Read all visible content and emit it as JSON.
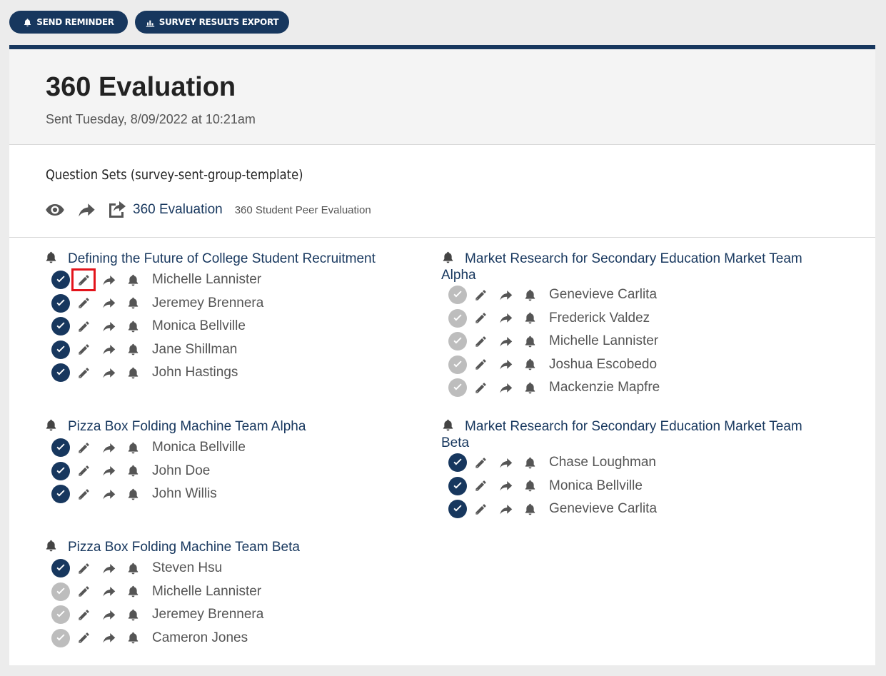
{
  "toolbar": {
    "send_reminder": "SEND REMINDER",
    "survey_results_export": "SURVEY RESULTS EXPORT"
  },
  "header": {
    "title": "360 Evaluation",
    "sent": "Sent Tuesday, 8/09/2022 at 10:21am"
  },
  "question_sets": {
    "title": "Question Sets (survey-sent-group-template)",
    "link": "360 Evaluation",
    "description": "360 Student Peer Evaluation"
  },
  "groups": [
    {
      "name": "Defining the Future of College Student Recruitment",
      "members": [
        {
          "name": "Michelle Lannister",
          "status": "completed"
        },
        {
          "name": "Jeremey Brennera",
          "status": "completed"
        },
        {
          "name": "Monica Bellville",
          "status": "completed"
        },
        {
          "name": "Jane Shillman",
          "status": "completed"
        },
        {
          "name": "John Hastings",
          "status": "completed"
        }
      ]
    },
    {
      "name": "Pizza Box Folding Machine Team Alpha",
      "members": [
        {
          "name": "Monica Bellville",
          "status": "completed"
        },
        {
          "name": "John Doe",
          "status": "completed"
        },
        {
          "name": "John Willis",
          "status": "completed"
        }
      ]
    },
    {
      "name": "Pizza Box Folding Machine Team Beta",
      "members": [
        {
          "name": "Steven Hsu",
          "status": "completed"
        },
        {
          "name": "Michelle Lannister",
          "status": "pending"
        },
        {
          "name": "Jeremey Brennera",
          "status": "pending"
        },
        {
          "name": "Cameron Jones",
          "status": "pending"
        }
      ]
    },
    {
      "name": "Market Research for Secondary Education Market Team Alpha",
      "members": [
        {
          "name": "Genevieve Carlita",
          "status": "pending"
        },
        {
          "name": "Frederick Valdez",
          "status": "pending"
        },
        {
          "name": "Michelle Lannister",
          "status": "pending"
        },
        {
          "name": "Joshua Escobedo",
          "status": "pending"
        },
        {
          "name": "Mackenzie Mapfre",
          "status": "pending"
        }
      ]
    },
    {
      "name": "Market Research for Secondary Education Market Team Beta",
      "members": [
        {
          "name": "Chase Loughman",
          "status": "completed"
        },
        {
          "name": "Monica Bellville",
          "status": "completed"
        },
        {
          "name": "Genevieve Carlita",
          "status": "completed"
        }
      ]
    }
  ],
  "colors": {
    "primary": "#17375e",
    "completed": "#17375e",
    "pending": "#bdbdbd",
    "highlight": "#e3141b"
  },
  "icons": {
    "status": "check-circle-icon",
    "edit": "pencil-icon",
    "forward": "share-icon",
    "remind": "bell-icon"
  }
}
